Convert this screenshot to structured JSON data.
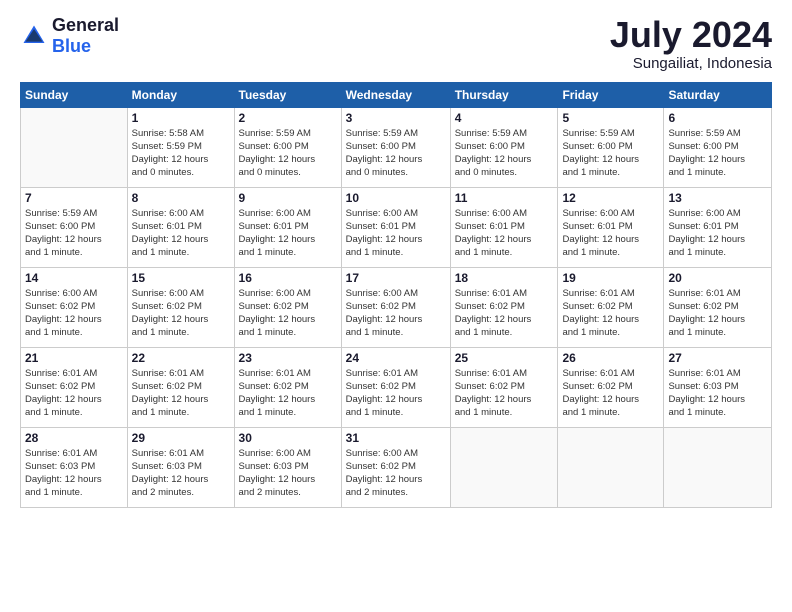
{
  "logo": {
    "general": "General",
    "blue": "Blue"
  },
  "header": {
    "month": "July 2024",
    "location": "Sungailiat, Indonesia"
  },
  "days_of_week": [
    "Sunday",
    "Monday",
    "Tuesday",
    "Wednesday",
    "Thursday",
    "Friday",
    "Saturday"
  ],
  "weeks": [
    [
      {
        "day": "",
        "info": ""
      },
      {
        "day": "1",
        "info": "Sunrise: 5:58 AM\nSunset: 5:59 PM\nDaylight: 12 hours\nand 0 minutes."
      },
      {
        "day": "2",
        "info": "Sunrise: 5:59 AM\nSunset: 6:00 PM\nDaylight: 12 hours\nand 0 minutes."
      },
      {
        "day": "3",
        "info": "Sunrise: 5:59 AM\nSunset: 6:00 PM\nDaylight: 12 hours\nand 0 minutes."
      },
      {
        "day": "4",
        "info": "Sunrise: 5:59 AM\nSunset: 6:00 PM\nDaylight: 12 hours\nand 0 minutes."
      },
      {
        "day": "5",
        "info": "Sunrise: 5:59 AM\nSunset: 6:00 PM\nDaylight: 12 hours\nand 1 minute."
      },
      {
        "day": "6",
        "info": "Sunrise: 5:59 AM\nSunset: 6:00 PM\nDaylight: 12 hours\nand 1 minute."
      }
    ],
    [
      {
        "day": "7",
        "info": "Sunrise: 5:59 AM\nSunset: 6:00 PM\nDaylight: 12 hours\nand 1 minute."
      },
      {
        "day": "8",
        "info": "Sunrise: 6:00 AM\nSunset: 6:01 PM\nDaylight: 12 hours\nand 1 minute."
      },
      {
        "day": "9",
        "info": "Sunrise: 6:00 AM\nSunset: 6:01 PM\nDaylight: 12 hours\nand 1 minute."
      },
      {
        "day": "10",
        "info": "Sunrise: 6:00 AM\nSunset: 6:01 PM\nDaylight: 12 hours\nand 1 minute."
      },
      {
        "day": "11",
        "info": "Sunrise: 6:00 AM\nSunset: 6:01 PM\nDaylight: 12 hours\nand 1 minute."
      },
      {
        "day": "12",
        "info": "Sunrise: 6:00 AM\nSunset: 6:01 PM\nDaylight: 12 hours\nand 1 minute."
      },
      {
        "day": "13",
        "info": "Sunrise: 6:00 AM\nSunset: 6:01 PM\nDaylight: 12 hours\nand 1 minute."
      }
    ],
    [
      {
        "day": "14",
        "info": "Sunrise: 6:00 AM\nSunset: 6:02 PM\nDaylight: 12 hours\nand 1 minute."
      },
      {
        "day": "15",
        "info": "Sunrise: 6:00 AM\nSunset: 6:02 PM\nDaylight: 12 hours\nand 1 minute."
      },
      {
        "day": "16",
        "info": "Sunrise: 6:00 AM\nSunset: 6:02 PM\nDaylight: 12 hours\nand 1 minute."
      },
      {
        "day": "17",
        "info": "Sunrise: 6:00 AM\nSunset: 6:02 PM\nDaylight: 12 hours\nand 1 minute."
      },
      {
        "day": "18",
        "info": "Sunrise: 6:01 AM\nSunset: 6:02 PM\nDaylight: 12 hours\nand 1 minute."
      },
      {
        "day": "19",
        "info": "Sunrise: 6:01 AM\nSunset: 6:02 PM\nDaylight: 12 hours\nand 1 minute."
      },
      {
        "day": "20",
        "info": "Sunrise: 6:01 AM\nSunset: 6:02 PM\nDaylight: 12 hours\nand 1 minute."
      }
    ],
    [
      {
        "day": "21",
        "info": "Sunrise: 6:01 AM\nSunset: 6:02 PM\nDaylight: 12 hours\nand 1 minute."
      },
      {
        "day": "22",
        "info": "Sunrise: 6:01 AM\nSunset: 6:02 PM\nDaylight: 12 hours\nand 1 minute."
      },
      {
        "day": "23",
        "info": "Sunrise: 6:01 AM\nSunset: 6:02 PM\nDaylight: 12 hours\nand 1 minute."
      },
      {
        "day": "24",
        "info": "Sunrise: 6:01 AM\nSunset: 6:02 PM\nDaylight: 12 hours\nand 1 minute."
      },
      {
        "day": "25",
        "info": "Sunrise: 6:01 AM\nSunset: 6:02 PM\nDaylight: 12 hours\nand 1 minute."
      },
      {
        "day": "26",
        "info": "Sunrise: 6:01 AM\nSunset: 6:02 PM\nDaylight: 12 hours\nand 1 minute."
      },
      {
        "day": "27",
        "info": "Sunrise: 6:01 AM\nSunset: 6:03 PM\nDaylight: 12 hours\nand 1 minute."
      }
    ],
    [
      {
        "day": "28",
        "info": "Sunrise: 6:01 AM\nSunset: 6:03 PM\nDaylight: 12 hours\nand 1 minute."
      },
      {
        "day": "29",
        "info": "Sunrise: 6:01 AM\nSunset: 6:03 PM\nDaylight: 12 hours\nand 2 minutes."
      },
      {
        "day": "30",
        "info": "Sunrise: 6:00 AM\nSunset: 6:03 PM\nDaylight: 12 hours\nand 2 minutes."
      },
      {
        "day": "31",
        "info": "Sunrise: 6:00 AM\nSunset: 6:02 PM\nDaylight: 12 hours\nand 2 minutes."
      },
      {
        "day": "",
        "info": ""
      },
      {
        "day": "",
        "info": ""
      },
      {
        "day": "",
        "info": ""
      }
    ]
  ]
}
